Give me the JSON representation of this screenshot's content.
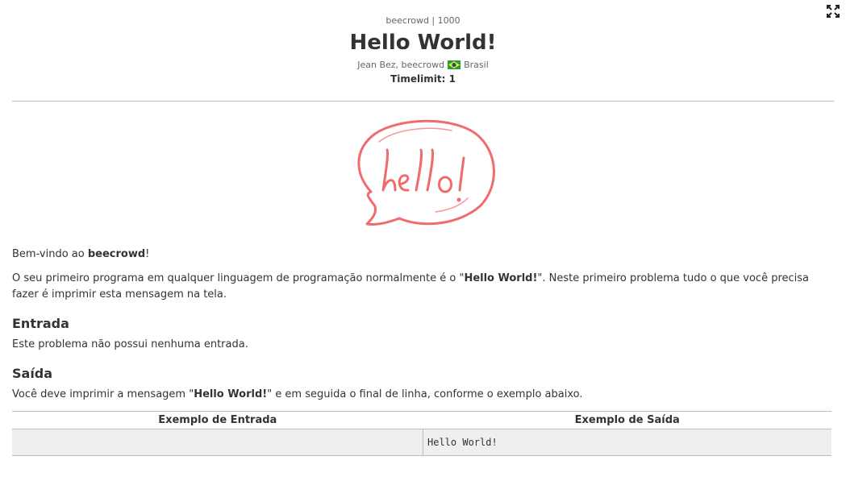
{
  "problem": {
    "crumb": "beecrowd | 1000",
    "title": "Hello World!",
    "author": "Jean Bez, beecrowd",
    "country": "Brasil",
    "timelimit_label": "Timelimit:",
    "timelimit_value": "1"
  },
  "description": {
    "welcome_pre": "Bem-vindo ao ",
    "welcome_bold": "beecrowd",
    "welcome_post": "!",
    "intro_pre": "O seu primeiro programa em qualquer linguagem de programação normalmente é o \"",
    "intro_bold": "Hello World!",
    "intro_post": "\". Neste primeiro problema tudo o que você precisa fazer é imprimir esta mensagem na tela."
  },
  "input_section": {
    "heading": "Entrada",
    "text": "Este problema não possui nenhuma entrada."
  },
  "output_section": {
    "heading": "Saída",
    "text_pre": "Você deve imprimir a mensagem \"",
    "text_bold": "Hello World!",
    "text_post": "\" e em seguida o final de linha, conforme o exemplo abaixo."
  },
  "examples": {
    "input_header": "Exemplo de Entrada",
    "output_header": "Exemplo de Saída",
    "input_value": "",
    "output_value": "Hello World!"
  },
  "illustration": {
    "icon": "hello-speech-bubble",
    "color": "#f06b6e"
  },
  "icons": {
    "expand": "expand-icon",
    "flag": "brazil-flag-icon"
  }
}
